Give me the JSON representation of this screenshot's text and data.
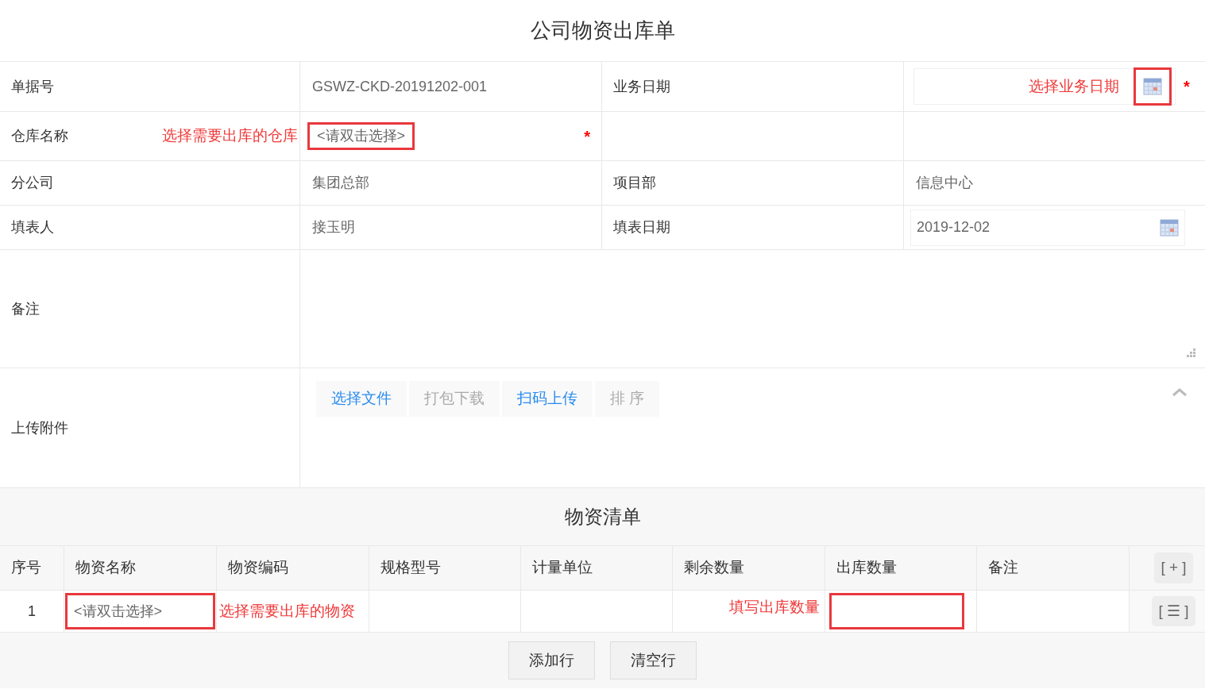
{
  "title": "公司物资出库单",
  "form": {
    "doc_no": {
      "label": "单据号",
      "value": "GSWZ-CKD-20191202-001"
    },
    "biz_date": {
      "label": "业务日期",
      "note": "选择业务日期",
      "icon_highlighted": true,
      "required_mark": "*"
    },
    "warehouse": {
      "label": "仓库名称",
      "note": "选择需要出库的仓库",
      "value": "<请双击选择>",
      "highlighted": true,
      "required_mark": "*"
    },
    "branch": {
      "label": "分公司",
      "value": "集团总部"
    },
    "project": {
      "label": "项目部",
      "value": "信息中心"
    },
    "filler": {
      "label": "填表人",
      "value": "接玉明"
    },
    "fill_date": {
      "label": "填表日期",
      "value": "2019-12-02"
    },
    "remarks": {
      "label": "备注"
    },
    "attachments": {
      "label": "上传附件",
      "expanded": true,
      "buttons": [
        {
          "label": "选择文件",
          "disabled": false
        },
        {
          "label": "打包下载",
          "disabled": true
        },
        {
          "label": "扫码上传",
          "disabled": false
        },
        {
          "label": "排 序",
          "disabled": true
        }
      ]
    }
  },
  "materials": {
    "title": "物资清单",
    "columns": [
      "序号",
      "物资名称",
      "物资编码",
      "规格型号",
      "计量单位",
      "剩余数量",
      "出库数量",
      "备注"
    ],
    "add_symbol": "[ + ]",
    "rows": [
      {
        "index": "1",
        "name": "<请双击选择>",
        "name_highlighted": true,
        "code_note": "选择需要出库的物资",
        "remaining_note": "填写出库数量",
        "quantity_highlighted": true,
        "menu_symbol": "[ ☰ ]"
      }
    ]
  },
  "buttons": [
    "添加行",
    "清空行"
  ]
}
